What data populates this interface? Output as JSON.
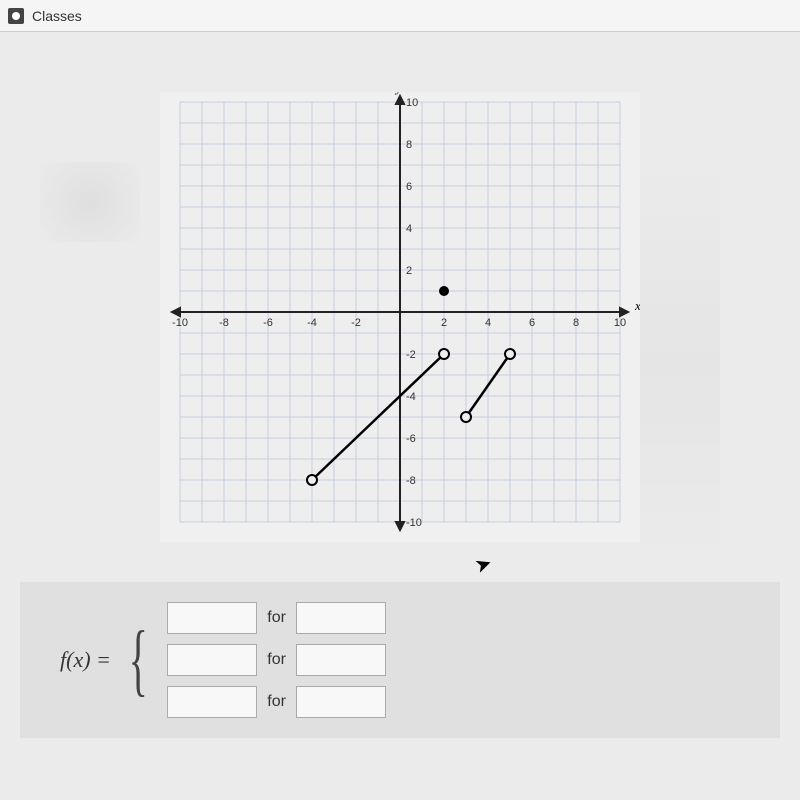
{
  "tab": {
    "label": "Classes"
  },
  "axes": {
    "x_label": "x",
    "y_label": "y"
  },
  "ticks": {
    "x": [
      "-10",
      "-8",
      "-6",
      "-4",
      "-2",
      "2",
      "4",
      "6",
      "8",
      "10"
    ],
    "y_pos": [
      "10",
      "8",
      "6",
      "4",
      "2"
    ],
    "y_neg": [
      "-2",
      "-4",
      "-6",
      "-8",
      "-10"
    ]
  },
  "equation": {
    "lhs": "f(x) =",
    "for_label": "for"
  },
  "chart_data": {
    "type": "scatter",
    "title": "",
    "xlabel": "x",
    "ylabel": "y",
    "xlim": [
      -10,
      10
    ],
    "ylim": [
      -10,
      10
    ],
    "segments": [
      {
        "description": "line segment, open both ends",
        "start": {
          "x": -4,
          "y": -8,
          "open": true
        },
        "end": {
          "x": 2,
          "y": -2,
          "open": true
        }
      },
      {
        "description": "line segment, open both ends",
        "start": {
          "x": 3,
          "y": -5,
          "open": true
        },
        "end": {
          "x": 5,
          "y": -2,
          "open": true
        }
      }
    ],
    "points": [
      {
        "x": 2,
        "y": 1,
        "open": false,
        "description": "closed point"
      }
    ]
  }
}
